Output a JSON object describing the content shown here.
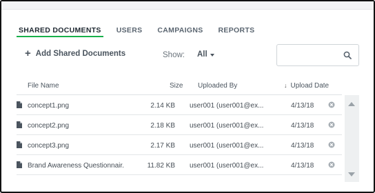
{
  "tabs": [
    {
      "label": "SHARED DOCUMENTS",
      "active": true
    },
    {
      "label": "USERS",
      "active": false
    },
    {
      "label": "CAMPAIGNS",
      "active": false
    },
    {
      "label": "REPORTS",
      "active": false
    }
  ],
  "toolbar": {
    "add_label": "Add Shared Documents",
    "show_label": "Show:",
    "show_value": "All",
    "search_placeholder": ""
  },
  "table": {
    "columns": {
      "name": "File Name",
      "size": "Size",
      "uploaded_by": "Uploaded By",
      "upload_date": "Upload Date"
    },
    "sort_column": "upload_date",
    "sort_direction": "descending",
    "rows": [
      {
        "name": "concept1.png",
        "size": "2.14 KB",
        "uploaded_by": "user001 (user001@ex...",
        "date": "4/13/18"
      },
      {
        "name": "concept2.png",
        "size": "2.18 KB",
        "uploaded_by": "user001 (user001@ex...",
        "date": "4/13/18"
      },
      {
        "name": "concept3.png",
        "size": "2.17 KB",
        "uploaded_by": "user001 (user001@ex...",
        "date": "4/13/18"
      },
      {
        "name": "Brand Awareness Questionnair...",
        "size": "11.82 KB",
        "uploaded_by": "user001 (user001@ex...",
        "date": "4/13/18"
      }
    ]
  },
  "colors": {
    "accent": "#18b04a",
    "text": "#3a4046",
    "border": "#dfe2e5"
  }
}
